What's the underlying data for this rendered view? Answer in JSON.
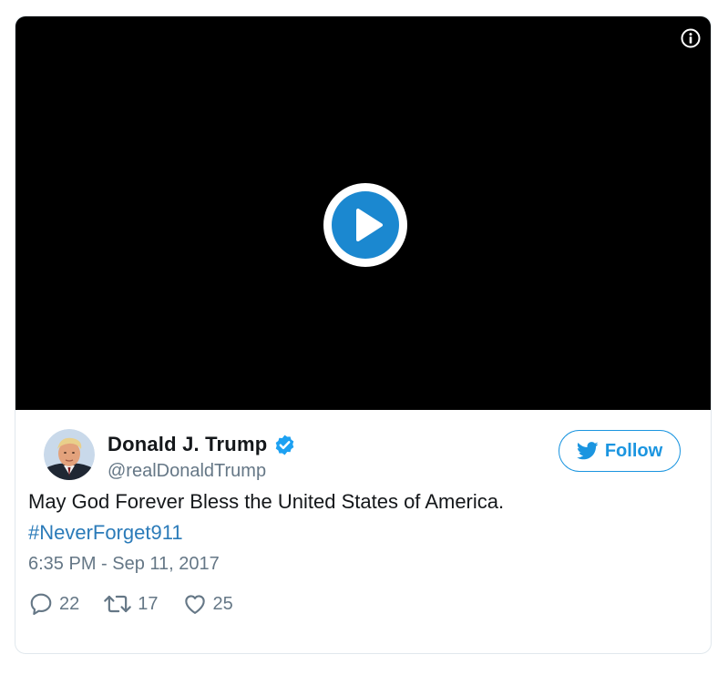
{
  "video": {
    "background_color": "#000000",
    "play_icon": "play-circle-icon",
    "info_icon": "info-icon"
  },
  "author": {
    "display_name": "Donald J. Trump",
    "handle": "@realDonaldTrump",
    "verified": true,
    "verified_color": "#1da1f2"
  },
  "follow_button": {
    "label": "Follow",
    "icon": "twitter-bird-icon",
    "color": "#1b95e0"
  },
  "tweet": {
    "text": "May God Forever Bless the United States of America.",
    "hashtag": "#NeverForget911",
    "hashtag_color": "#2b7bb9",
    "timestamp": "6:35 PM - Sep 11, 2017"
  },
  "actions": {
    "reply_count": "22",
    "retweet_count": "17",
    "like_count": "25"
  }
}
